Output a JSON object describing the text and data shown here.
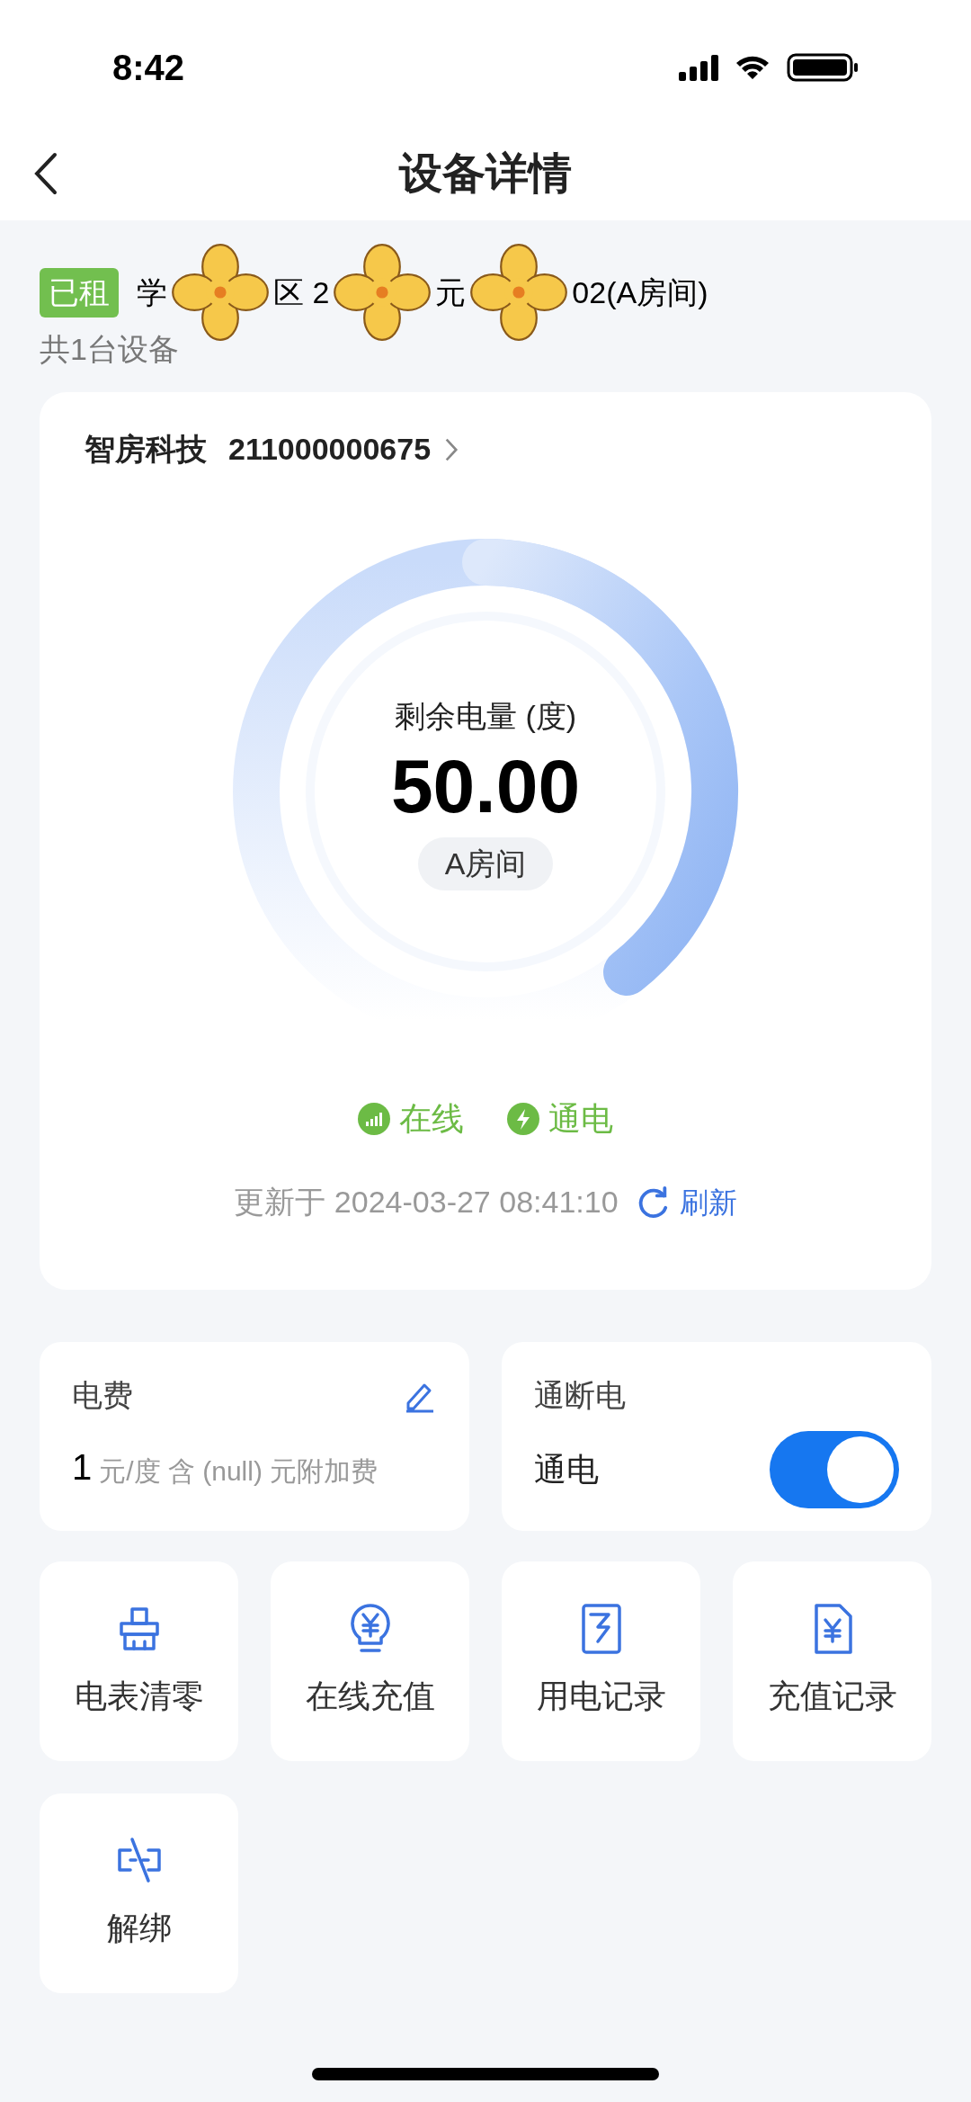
{
  "status_bar": {
    "time": "8:42"
  },
  "header": {
    "title": "设备详情"
  },
  "property": {
    "tag": "已租",
    "address_parts": [
      "学",
      "区 2",
      "元",
      "02(A房间)"
    ],
    "device_count": "共1台设备"
  },
  "device": {
    "brand": "智房科技",
    "serial": "211000000675",
    "gauge_label": "剩余电量 (度)",
    "remaining": "50.00",
    "room": "A房间",
    "statuses": [
      {
        "kind": "signal",
        "label": "在线"
      },
      {
        "kind": "power",
        "label": "通电"
      }
    ],
    "updated": "更新于 2024-03-27 08:41:10",
    "refresh": "刷新"
  },
  "price_card": {
    "title": "电费",
    "amount": "1",
    "unit": "元/度 含 (null) 元附加费"
  },
  "power_card": {
    "title": "通断电",
    "label": "通电",
    "on": true
  },
  "actions": [
    {
      "kind": "reset",
      "label": "电表清零"
    },
    {
      "kind": "recharge",
      "label": "在线充值"
    },
    {
      "kind": "usage",
      "label": "用电记录"
    },
    {
      "kind": "records",
      "label": "充值记录"
    },
    {
      "kind": "unbind",
      "label": "解绑"
    }
  ]
}
